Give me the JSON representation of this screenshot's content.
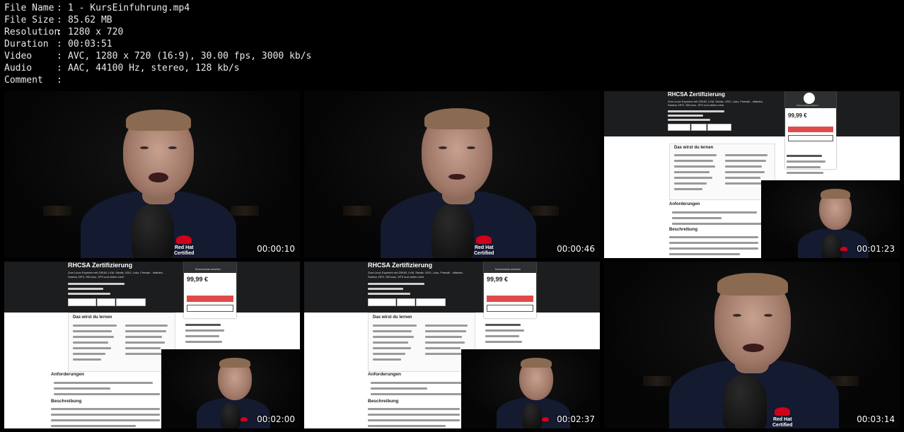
{
  "meta": {
    "file_name": {
      "key": "File Name",
      "value": "1 - KursEinfuhrung.mp4"
    },
    "file_size": {
      "key": "File Size",
      "value": "85.62 MB"
    },
    "resolution": {
      "key": "Resolution",
      "value": "1280 x 720"
    },
    "duration": {
      "key": "Duration",
      "value": "00:03:51"
    },
    "video": {
      "key": "Video",
      "value": "AVC, 1280 x 720 (16:9), 30.00 fps, 3000 kb/s"
    },
    "audio": {
      "key": "Audio",
      "value": "AAC, 44100 Hz, stereo, 128 kb/s"
    },
    "comment": {
      "key": "Comment",
      "value": ""
    },
    "separator": ":"
  },
  "frames": [
    {
      "timestamp": "00:00:10",
      "kind": "presenter"
    },
    {
      "timestamp": "00:00:46",
      "kind": "presenter"
    },
    {
      "timestamp": "00:01:23",
      "kind": "webpage"
    },
    {
      "timestamp": "00:02:00",
      "kind": "webpage"
    },
    {
      "timestamp": "00:02:37",
      "kind": "webpage"
    },
    {
      "timestamp": "00:03:14",
      "kind": "presenter"
    }
  ],
  "webpage": {
    "title": "RHCSA Zertifizierung",
    "subtitle_1": "Zum Linux Experten mit GRUB, LVM, Stratis, VDO, Luks, Firewall - nftables,",
    "subtitle_2": "Samba, NFS, SELinux, XFS und vieles mehr",
    "preview_label": "Kursvorschau ansehen",
    "price": "99,99 €",
    "learn_heading": "Das wirst du lernen",
    "requirements_heading": "Anforderungen",
    "description_heading": "Beschreibung"
  },
  "logo": {
    "line1": "Red Hat",
    "line2": "Certified"
  },
  "colors": {
    "background": "#000000",
    "udemy_header": "#1c1d1f",
    "buy_button": "#e04a4a",
    "redhat": "#d0021b"
  }
}
